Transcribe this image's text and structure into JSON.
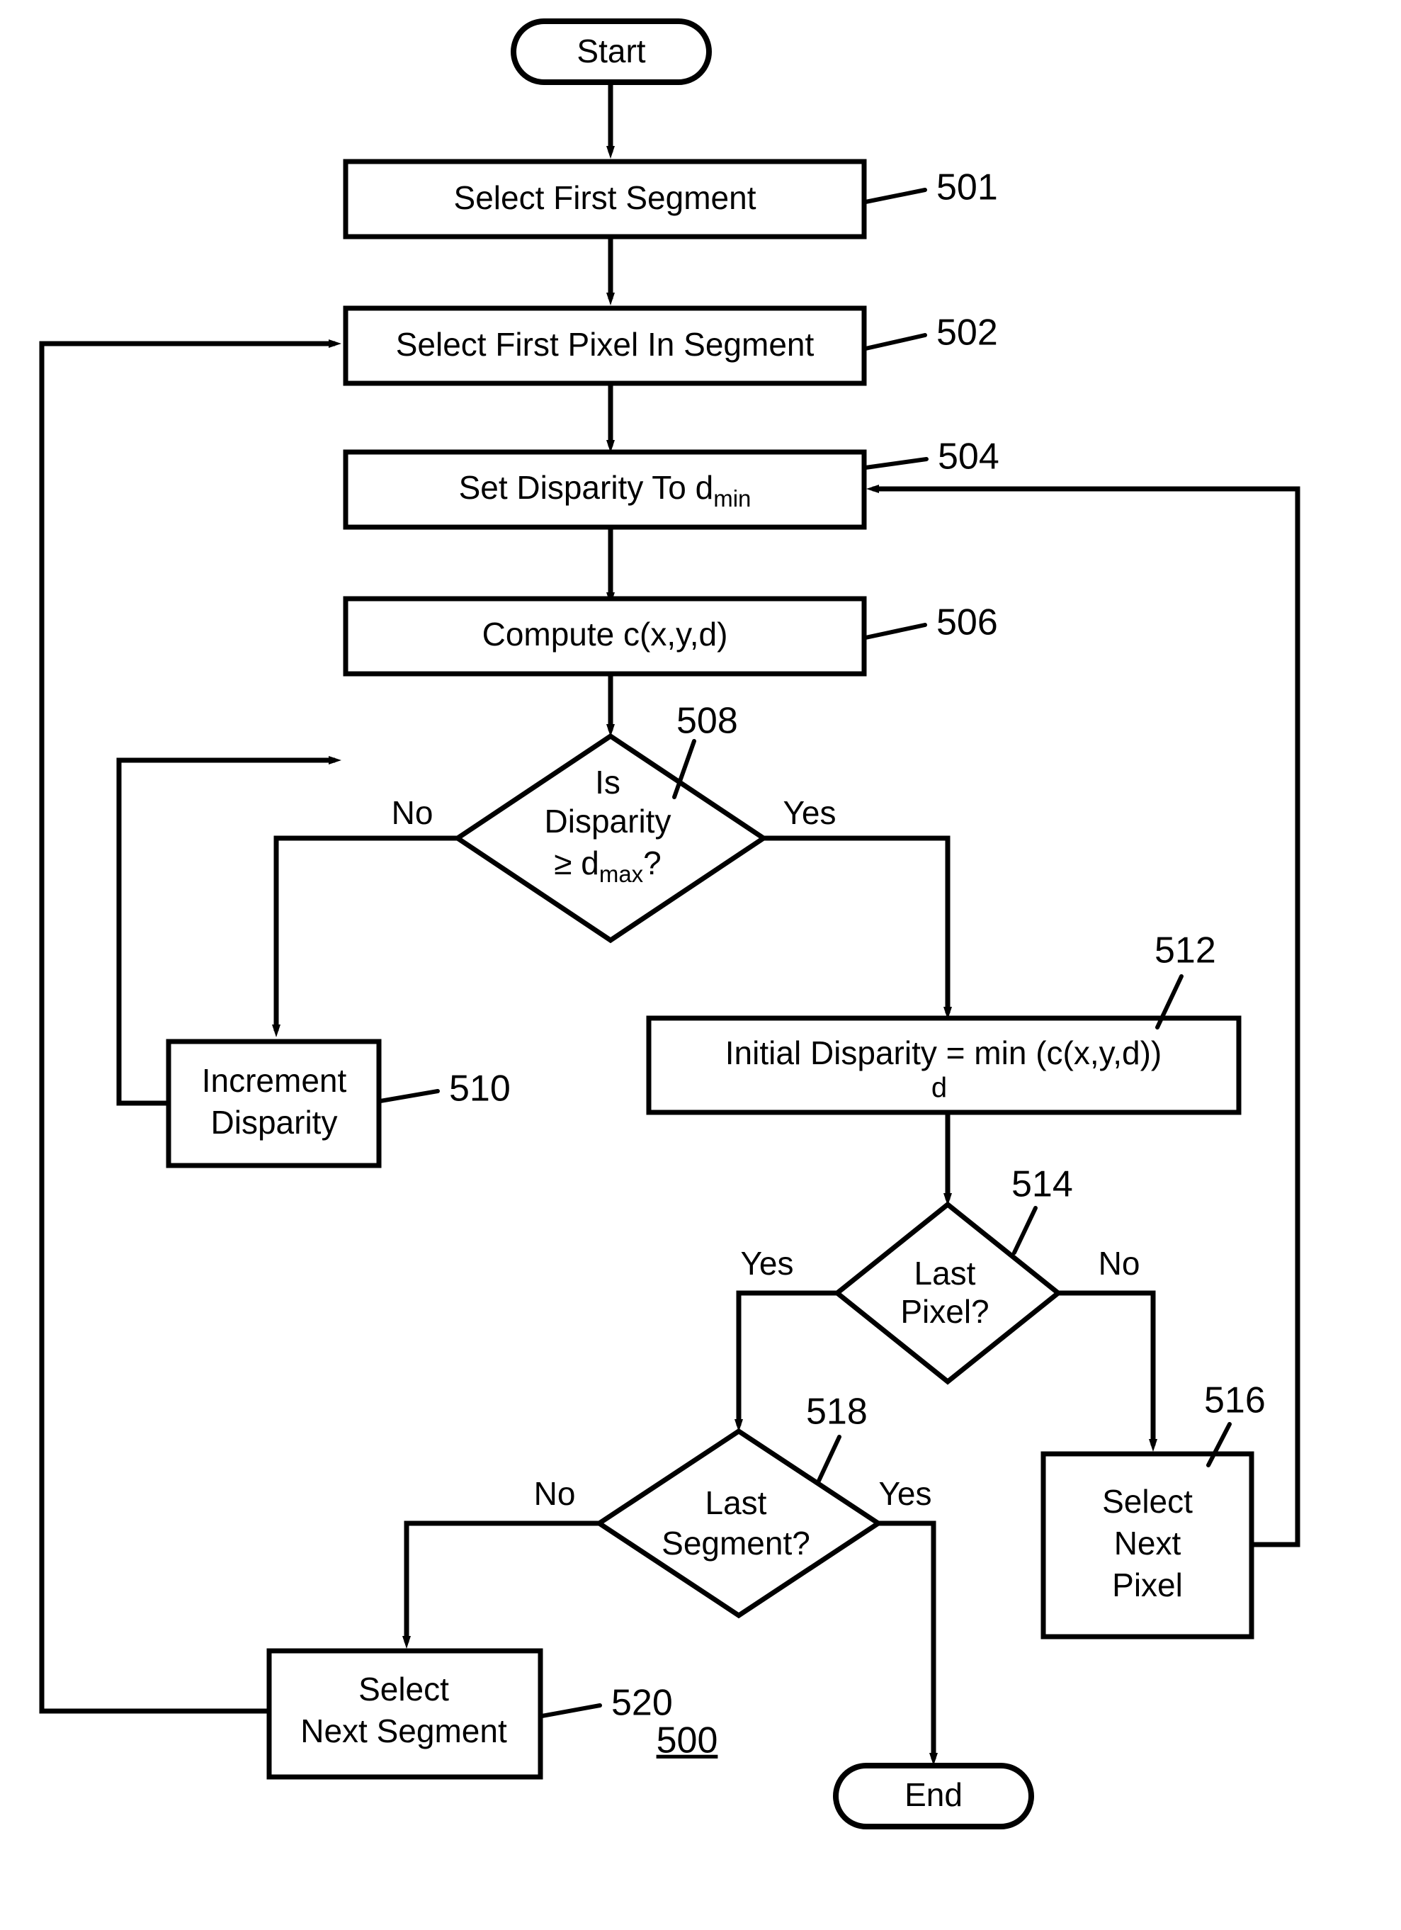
{
  "figure": {
    "number": "500",
    "type": "flowchart"
  },
  "nodes": {
    "start": {
      "label": "Start",
      "shape": "terminator"
    },
    "n501": {
      "label": "Select First Segment",
      "ref": "501",
      "shape": "process"
    },
    "n502": {
      "label": "Select First Pixel In Segment",
      "ref": "502",
      "shape": "process"
    },
    "n504": {
      "label": "Set Disparity To d",
      "sub": "min",
      "ref": "504",
      "shape": "process"
    },
    "n506": {
      "label": "Compute c(x,y,d)",
      "ref": "506",
      "shape": "process"
    },
    "n508": {
      "line1": "Is",
      "line2": "Disparity",
      "line3_op": "≥ d",
      "line3_sub": "max",
      "line3_tail": "?",
      "ref": "508",
      "shape": "decision"
    },
    "n510": {
      "line1": "Increment",
      "line2": "Disparity",
      "ref": "510",
      "shape": "process"
    },
    "n512": {
      "lead": "Initial Disparity  =  ",
      "min": "min",
      "minsub": "d",
      "expr": " (c(x,y,d))",
      "ref": "512",
      "shape": "process"
    },
    "n514": {
      "line1": "Last",
      "line2": "Pixel?",
      "ref": "514",
      "shape": "decision"
    },
    "n516": {
      "line1": "Select",
      "line2": "Next",
      "line3": "Pixel",
      "ref": "516",
      "shape": "process"
    },
    "n518": {
      "line1": "Last",
      "line2": "Segment?",
      "ref": "518",
      "shape": "decision"
    },
    "n520": {
      "line1": "Select",
      "line2": "Next Segment",
      "ref": "520",
      "shape": "process"
    },
    "end": {
      "label": "End",
      "shape": "terminator"
    }
  },
  "branch_labels": {
    "d508_no": "No",
    "d508_yes": "Yes",
    "d514_yes": "Yes",
    "d514_no": "No",
    "d518_no": "No",
    "d518_yes": "Yes"
  },
  "colors": {
    "stroke": "#000000",
    "fill": "#ffffff",
    "text": "#000000"
  }
}
